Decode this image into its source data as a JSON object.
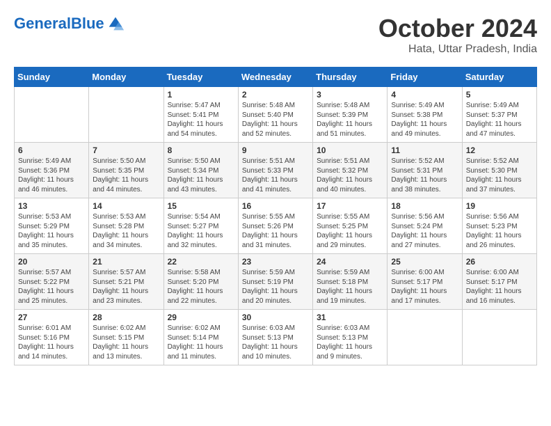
{
  "logo": {
    "text_general": "General",
    "text_blue": "Blue"
  },
  "title": "October 2024",
  "location": "Hata, Uttar Pradesh, India",
  "days_of_week": [
    "Sunday",
    "Monday",
    "Tuesday",
    "Wednesday",
    "Thursday",
    "Friday",
    "Saturday"
  ],
  "weeks": [
    [
      {
        "day": "",
        "empty": true
      },
      {
        "day": "",
        "empty": true
      },
      {
        "day": "1",
        "sunrise": "Sunrise: 5:47 AM",
        "sunset": "Sunset: 5:41 PM",
        "daylight": "Daylight: 11 hours and 54 minutes."
      },
      {
        "day": "2",
        "sunrise": "Sunrise: 5:48 AM",
        "sunset": "Sunset: 5:40 PM",
        "daylight": "Daylight: 11 hours and 52 minutes."
      },
      {
        "day": "3",
        "sunrise": "Sunrise: 5:48 AM",
        "sunset": "Sunset: 5:39 PM",
        "daylight": "Daylight: 11 hours and 51 minutes."
      },
      {
        "day": "4",
        "sunrise": "Sunrise: 5:49 AM",
        "sunset": "Sunset: 5:38 PM",
        "daylight": "Daylight: 11 hours and 49 minutes."
      },
      {
        "day": "5",
        "sunrise": "Sunrise: 5:49 AM",
        "sunset": "Sunset: 5:37 PM",
        "daylight": "Daylight: 11 hours and 47 minutes."
      }
    ],
    [
      {
        "day": "6",
        "sunrise": "Sunrise: 5:49 AM",
        "sunset": "Sunset: 5:36 PM",
        "daylight": "Daylight: 11 hours and 46 minutes."
      },
      {
        "day": "7",
        "sunrise": "Sunrise: 5:50 AM",
        "sunset": "Sunset: 5:35 PM",
        "daylight": "Daylight: 11 hours and 44 minutes."
      },
      {
        "day": "8",
        "sunrise": "Sunrise: 5:50 AM",
        "sunset": "Sunset: 5:34 PM",
        "daylight": "Daylight: 11 hours and 43 minutes."
      },
      {
        "day": "9",
        "sunrise": "Sunrise: 5:51 AM",
        "sunset": "Sunset: 5:33 PM",
        "daylight": "Daylight: 11 hours and 41 minutes."
      },
      {
        "day": "10",
        "sunrise": "Sunrise: 5:51 AM",
        "sunset": "Sunset: 5:32 PM",
        "daylight": "Daylight: 11 hours and 40 minutes."
      },
      {
        "day": "11",
        "sunrise": "Sunrise: 5:52 AM",
        "sunset": "Sunset: 5:31 PM",
        "daylight": "Daylight: 11 hours and 38 minutes."
      },
      {
        "day": "12",
        "sunrise": "Sunrise: 5:52 AM",
        "sunset": "Sunset: 5:30 PM",
        "daylight": "Daylight: 11 hours and 37 minutes."
      }
    ],
    [
      {
        "day": "13",
        "sunrise": "Sunrise: 5:53 AM",
        "sunset": "Sunset: 5:29 PM",
        "daylight": "Daylight: 11 hours and 35 minutes."
      },
      {
        "day": "14",
        "sunrise": "Sunrise: 5:53 AM",
        "sunset": "Sunset: 5:28 PM",
        "daylight": "Daylight: 11 hours and 34 minutes."
      },
      {
        "day": "15",
        "sunrise": "Sunrise: 5:54 AM",
        "sunset": "Sunset: 5:27 PM",
        "daylight": "Daylight: 11 hours and 32 minutes."
      },
      {
        "day": "16",
        "sunrise": "Sunrise: 5:55 AM",
        "sunset": "Sunset: 5:26 PM",
        "daylight": "Daylight: 11 hours and 31 minutes."
      },
      {
        "day": "17",
        "sunrise": "Sunrise: 5:55 AM",
        "sunset": "Sunset: 5:25 PM",
        "daylight": "Daylight: 11 hours and 29 minutes."
      },
      {
        "day": "18",
        "sunrise": "Sunrise: 5:56 AM",
        "sunset": "Sunset: 5:24 PM",
        "daylight": "Daylight: 11 hours and 27 minutes."
      },
      {
        "day": "19",
        "sunrise": "Sunrise: 5:56 AM",
        "sunset": "Sunset: 5:23 PM",
        "daylight": "Daylight: 11 hours and 26 minutes."
      }
    ],
    [
      {
        "day": "20",
        "sunrise": "Sunrise: 5:57 AM",
        "sunset": "Sunset: 5:22 PM",
        "daylight": "Daylight: 11 hours and 25 minutes."
      },
      {
        "day": "21",
        "sunrise": "Sunrise: 5:57 AM",
        "sunset": "Sunset: 5:21 PM",
        "daylight": "Daylight: 11 hours and 23 minutes."
      },
      {
        "day": "22",
        "sunrise": "Sunrise: 5:58 AM",
        "sunset": "Sunset: 5:20 PM",
        "daylight": "Daylight: 11 hours and 22 minutes."
      },
      {
        "day": "23",
        "sunrise": "Sunrise: 5:59 AM",
        "sunset": "Sunset: 5:19 PM",
        "daylight": "Daylight: 11 hours and 20 minutes."
      },
      {
        "day": "24",
        "sunrise": "Sunrise: 5:59 AM",
        "sunset": "Sunset: 5:18 PM",
        "daylight": "Daylight: 11 hours and 19 minutes."
      },
      {
        "day": "25",
        "sunrise": "Sunrise: 6:00 AM",
        "sunset": "Sunset: 5:17 PM",
        "daylight": "Daylight: 11 hours and 17 minutes."
      },
      {
        "day": "26",
        "sunrise": "Sunrise: 6:00 AM",
        "sunset": "Sunset: 5:17 PM",
        "daylight": "Daylight: 11 hours and 16 minutes."
      }
    ],
    [
      {
        "day": "27",
        "sunrise": "Sunrise: 6:01 AM",
        "sunset": "Sunset: 5:16 PM",
        "daylight": "Daylight: 11 hours and 14 minutes."
      },
      {
        "day": "28",
        "sunrise": "Sunrise: 6:02 AM",
        "sunset": "Sunset: 5:15 PM",
        "daylight": "Daylight: 11 hours and 13 minutes."
      },
      {
        "day": "29",
        "sunrise": "Sunrise: 6:02 AM",
        "sunset": "Sunset: 5:14 PM",
        "daylight": "Daylight: 11 hours and 11 minutes."
      },
      {
        "day": "30",
        "sunrise": "Sunrise: 6:03 AM",
        "sunset": "Sunset: 5:13 PM",
        "daylight": "Daylight: 11 hours and 10 minutes."
      },
      {
        "day": "31",
        "sunrise": "Sunrise: 6:03 AM",
        "sunset": "Sunset: 5:13 PM",
        "daylight": "Daylight: 11 hours and 9 minutes."
      },
      {
        "day": "",
        "empty": true
      },
      {
        "day": "",
        "empty": true
      }
    ]
  ]
}
